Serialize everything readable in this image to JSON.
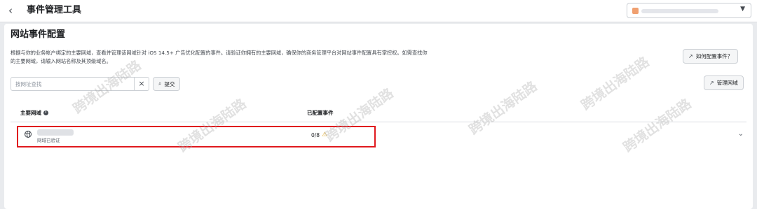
{
  "header": {
    "back_icon": "chevron-left-icon",
    "title": "事件管理工具",
    "account_selector": {
      "caret_icon": "caret-down-icon",
      "accent": "#f0a070"
    }
  },
  "page": {
    "section_title": "网站事件配置",
    "description": "根据与你的业务帐户绑定的主要网域，查看并管理该网域针对 iOS 14.5+ 广告优化配置的事件。请验证你拥有的主要网域，确保你的商务管理平台对网站事件配置具有掌控权。如需查找你的主要网域，请输入网站名称及其顶级域名。",
    "how_to_button": "如何配置事件？",
    "manage_domains_button": "管理网域",
    "search": {
      "placeholder": "按网址查找",
      "value": "",
      "clear_icon": "×",
      "submit_label": "提交"
    },
    "table": {
      "headers": {
        "domain": "主要网域",
        "events": "已配置事件"
      },
      "rows": [
        {
          "domain_status": "网域已验证",
          "events": "0/8",
          "status_icon": "warning-icon"
        }
      ]
    },
    "watermark": "跨境出海陆路"
  },
  "colors": {
    "highlight": "#e0191e",
    "warning": "#e6a817"
  }
}
